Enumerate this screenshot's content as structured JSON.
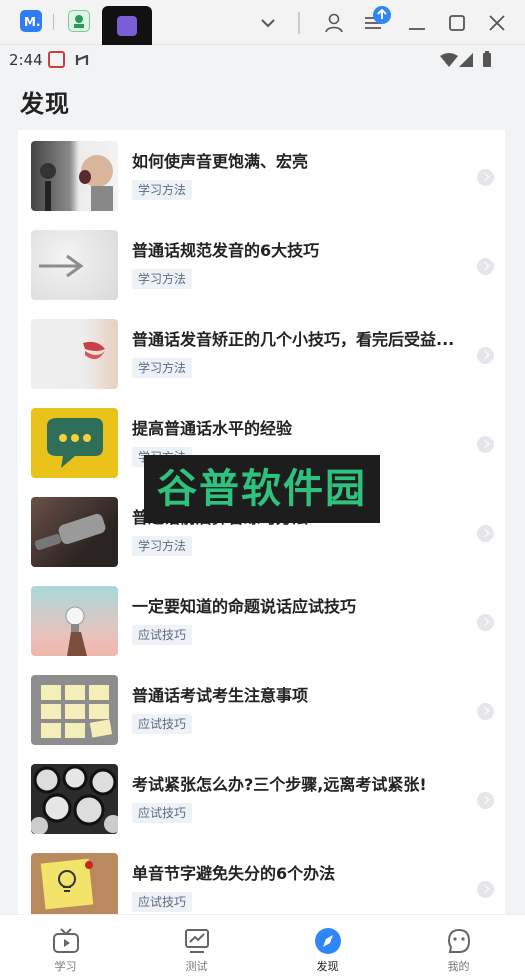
{
  "status_bar": {
    "time": "2:44"
  },
  "page": {
    "title": "发现"
  },
  "articles": [
    {
      "title": "如何使声音更饱满、宏亮",
      "tag": "学习方法",
      "thumb": "shouting-child"
    },
    {
      "title": "普通话规范发音的6大技巧",
      "tag": "学习方法",
      "thumb": "arrow-on-wall"
    },
    {
      "title": "普通话发音矫正的几个小技巧，看完后受益...",
      "tag": "学习方法",
      "thumb": "lips"
    },
    {
      "title": "提高普通话水平的经验",
      "tag": "学习方法",
      "thumb": "speech-bubble"
    },
    {
      "title": "普通话前后鼻音练习方法",
      "tag": "学习方法",
      "thumb": "microphone"
    },
    {
      "title": "一定要知道的命题说话应试技巧",
      "tag": "应试技巧",
      "thumb": "lightbulb-hand"
    },
    {
      "title": "普通话考试考生注意事项",
      "tag": "应试技巧",
      "thumb": "sticky-notes"
    },
    {
      "title": "考试紧张怎么办?三个步骤,远离考试紧张!",
      "tag": "应试技巧",
      "thumb": "clocks"
    },
    {
      "title": "单音节字避免失分的6个办法",
      "tag": "应试技巧",
      "thumb": "idea-note"
    }
  ],
  "watermark": {
    "text": "谷普软件园"
  },
  "nav": {
    "items": [
      {
        "label": "学习",
        "icon": "tv-play-icon"
      },
      {
        "label": "测试",
        "icon": "chart-board-icon"
      },
      {
        "label": "发现",
        "icon": "compass-icon"
      },
      {
        "label": "我的",
        "icon": "smile-face-icon"
      }
    ],
    "active_index": 2
  },
  "colors": {
    "accent": "#2f86f6",
    "tag_bg": "#eef2f7",
    "tag_text": "#5a6b82"
  }
}
